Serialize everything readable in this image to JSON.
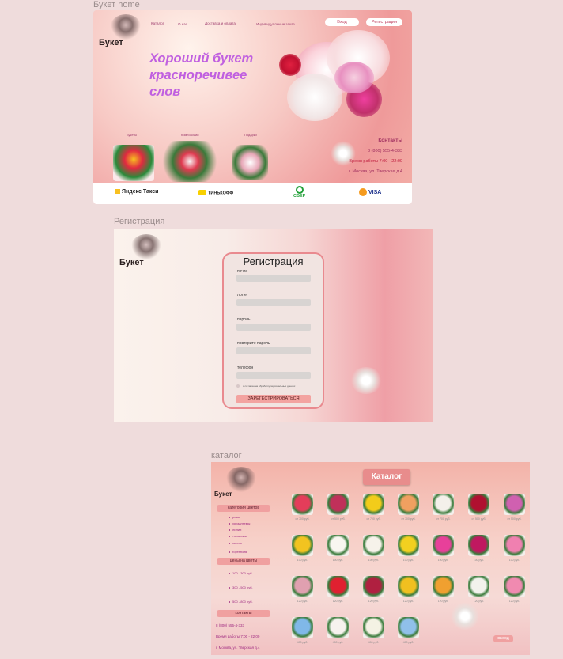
{
  "frames": {
    "home": {
      "label": "Букет home",
      "logo": "Букет",
      "nav": [
        "Каталог",
        "О нас",
        "Доставка и оплата",
        "Индивидуальные заказ"
      ],
      "login": "Вход",
      "register": "Регистрация",
      "headline": [
        "Хороший букет",
        "красноречивее",
        "слов"
      ],
      "categories": [
        "Букеты",
        "Композиции",
        "Подарки"
      ],
      "contacts": {
        "title": "Контакты",
        "phone": "8 (800) 555-4-333",
        "hours": "Время работы 7:00 - 22:00",
        "address": "г. Москва, ул. Тверская д.4"
      },
      "partners": [
        "Яндекс Такси",
        "ТИНЬКОФФ",
        "СБЕР",
        "VISA"
      ]
    },
    "registration": {
      "label": "Регистрация",
      "logo": "Букет",
      "title": "Регистрация",
      "fields": [
        "почта",
        "логин",
        "пароль",
        "повторите пароль",
        "телефон"
      ],
      "consent": "я согласен на обработку персональных данных",
      "submit": "ЗАРЕГЕСТРИРОВАТЬСЯ"
    },
    "catalog": {
      "label": "каталог",
      "logo": "Букет",
      "title": "Каталог",
      "sidebar": {
        "categories_title": "категории цветов",
        "categories": [
          "розы",
          "хризантемы",
          "лилии",
          "тюльпаны",
          "пионы",
          "гортензия"
        ],
        "prices_title": "цены на цветы",
        "prices": [
          "100 - 300 руб.",
          "300 - 500 руб.",
          "500 - 800 руб."
        ],
        "contacts_title": "контакты",
        "phone": "8 (800) 555-4-333",
        "hours": "Время работы 7:00 - 22:00",
        "address": "г. Москва, ул. Тверская д.4"
      },
      "products": [
        {
          "price": "от 700 руб.",
          "color": "#e43d5a"
        },
        {
          "price": "от 500 руб.",
          "color": "#c0305a"
        },
        {
          "price": "от 700 руб.",
          "color": "#f2cc1a"
        },
        {
          "price": "от 700 руб.",
          "color": "#f0a060"
        },
        {
          "price": "от 700 руб.",
          "color": "#f4f0ea"
        },
        {
          "price": "от 500 руб.",
          "color": "#b01030"
        },
        {
          "price": "от 500 руб.",
          "color": "#d060b0"
        },
        {
          "price": "100 руб.",
          "color": "#f2c320"
        },
        {
          "price": "100 руб.",
          "color": "#f8f6f0"
        },
        {
          "price": "100 руб.",
          "color": "#f6f2ea"
        },
        {
          "price": "100 руб.",
          "color": "#f2d020"
        },
        {
          "price": "100 руб.",
          "color": "#e8409a"
        },
        {
          "price": "100 руб.",
          "color": "#c01860"
        },
        {
          "price": "100 руб.",
          "color": "#f080b0"
        },
        {
          "price": "120 руб.",
          "color": "#e0a0b0"
        },
        {
          "price": "120 руб.",
          "color": "#e02030"
        },
        {
          "price": "120 руб.",
          "color": "#b02040"
        },
        {
          "price": "120 руб.",
          "color": "#f0c020"
        },
        {
          "price": "120 руб.",
          "color": "#f0a030"
        },
        {
          "price": "120 руб.",
          "color": "#f2f2ec"
        },
        {
          "price": "120 руб.",
          "color": "#f08ab0"
        },
        {
          "price": "400 руб.",
          "color": "#80b8e8"
        },
        {
          "price": "400 руб.",
          "color": "#f6f2ee"
        },
        {
          "price": "400 руб.",
          "color": "#f4f2e4"
        },
        {
          "price": "400 руб.",
          "color": "#90c0ea"
        }
      ],
      "exit": "выход"
    }
  }
}
